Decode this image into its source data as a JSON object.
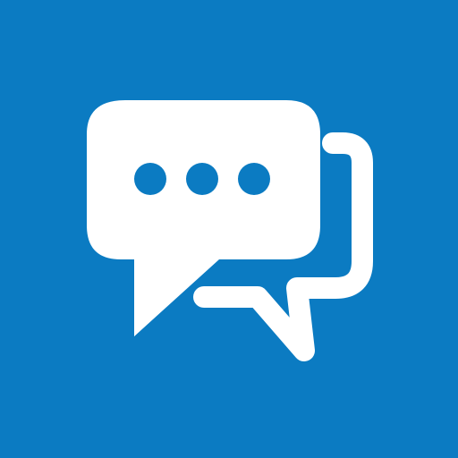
{
  "icon": {
    "name": "chat-bubbles-icon",
    "background_color": "#0B7BC2",
    "glyph_color": "#FFFFFF",
    "typing_dots": 3
  }
}
